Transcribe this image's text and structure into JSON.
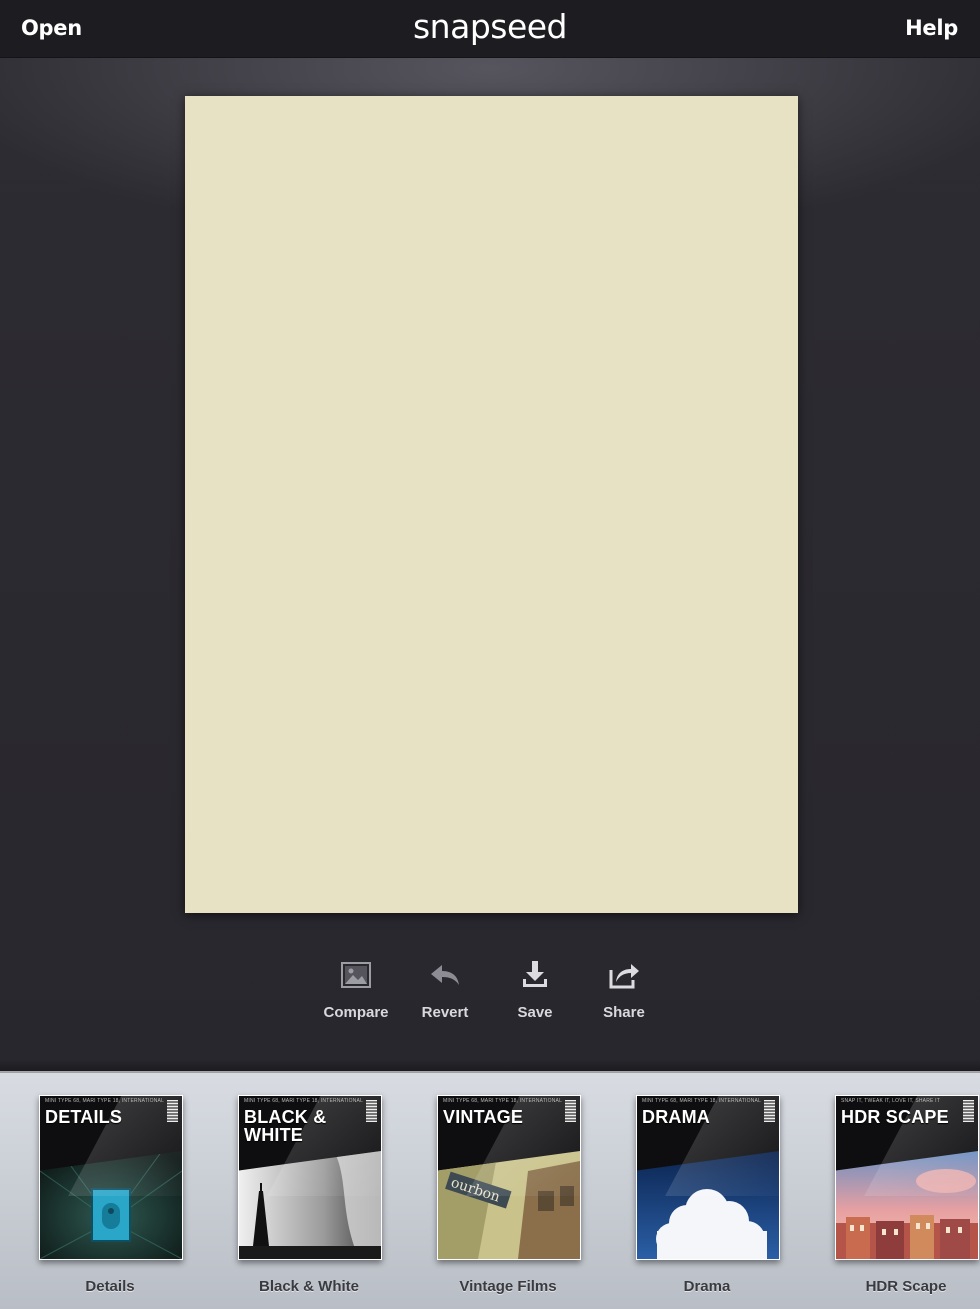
{
  "topbar": {
    "open_label": "Open",
    "app_title": "snapseed",
    "help_label": "Help"
  },
  "image": {
    "fill_color": "#e8e2c4"
  },
  "actions": [
    {
      "label": "Compare",
      "icon": "compare-image-icon"
    },
    {
      "label": "Revert",
      "icon": "revert-arrow-icon"
    },
    {
      "label": "Save",
      "icon": "download-icon"
    },
    {
      "label": "Share",
      "icon": "share-icon"
    }
  ],
  "filters": [
    {
      "cover_title": "DETAILS",
      "label": "Details",
      "cover_tagline": "MINI TYPE 68, MARI TYPE 18, INTERNATIONAL 8"
    },
    {
      "cover_title": "BLACK & WHITE",
      "label": "Black & White",
      "cover_tagline": "MINI TYPE 68, MARI TYPE 18, INTERNATIONAL 8"
    },
    {
      "cover_title": "VINTAGE",
      "label": "Vintage Films",
      "cover_tagline": "MINI TYPE 68, MARI TYPE 18, INTERNATIONAL 8",
      "sign_text": "ourbon"
    },
    {
      "cover_title": "DRAMA",
      "label": "Drama",
      "cover_tagline": "MINI TYPE 68, MARI TYPE 18, INTERNATIONAL 8"
    },
    {
      "cover_title": "HDR SCAPE",
      "label": "HDR Scape",
      "cover_tagline": "SNAP IT, TWEAK IT, LOVE IT, SHARE IT"
    }
  ],
  "colors": {
    "topbar_bg": "#1d1c20",
    "workarea_bg": "#2c2b31",
    "tray_bg": "#c9cdd3"
  }
}
